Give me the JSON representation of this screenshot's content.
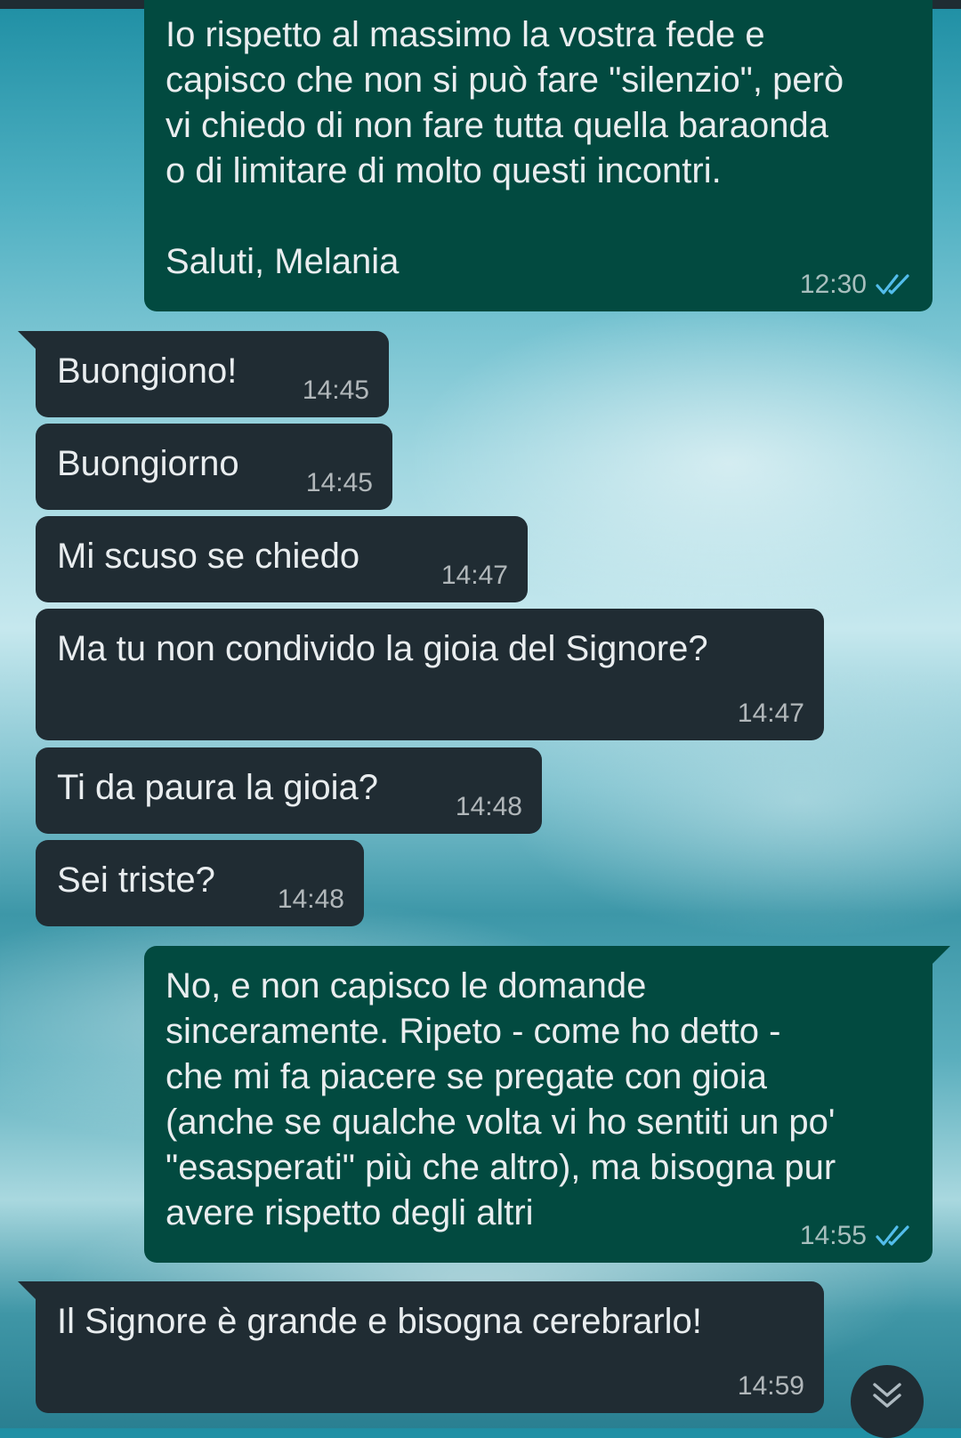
{
  "messages": [
    {
      "direction": "outgoing",
      "text": "Io rispetto al massimo la vostra fede e\ncapisco che non si può fare \"silenzio\", però\nvi chiedo di non fare tutta quella baraonda\no di limitare di molto questi incontri.\n\nSaluti, Melania",
      "time": "12:30",
      "status": "read"
    },
    {
      "direction": "incoming",
      "text": "Buongiono!",
      "time": "14:45"
    },
    {
      "direction": "incoming",
      "text": "Buongiorno",
      "time": "14:45"
    },
    {
      "direction": "incoming",
      "text": "Mi scuso se chiedo",
      "time": "14:47"
    },
    {
      "direction": "incoming",
      "text": "Ma tu non condivido la gioia del Signore?",
      "time": "14:47"
    },
    {
      "direction": "incoming",
      "text": "Ti da paura la gioia?",
      "time": "14:48"
    },
    {
      "direction": "incoming",
      "text": "Sei triste?",
      "time": "14:48"
    },
    {
      "direction": "outgoing",
      "text": "No, e non capisco le domande\nsinceramente. Ripeto - come ho detto -\nche mi fa piacere se pregate con gioia\n(anche se qualche volta vi ho sentiti un po'\n\"esasperati\" più che altro), ma bisogna pur\navere rispetto degli altri",
      "time": "14:55",
      "status": "read"
    },
    {
      "direction": "incoming",
      "text": "Il Signore è grande e bisogna cerebrarlo!",
      "time": "14:59"
    }
  ],
  "scroll_button": {
    "icon": "double-chevron-down-icon"
  },
  "colors": {
    "outgoing_bubble": "#024a40",
    "incoming_bubble": "#202c33",
    "read_ticks": "#53bdeb",
    "text": "#e9edef"
  }
}
